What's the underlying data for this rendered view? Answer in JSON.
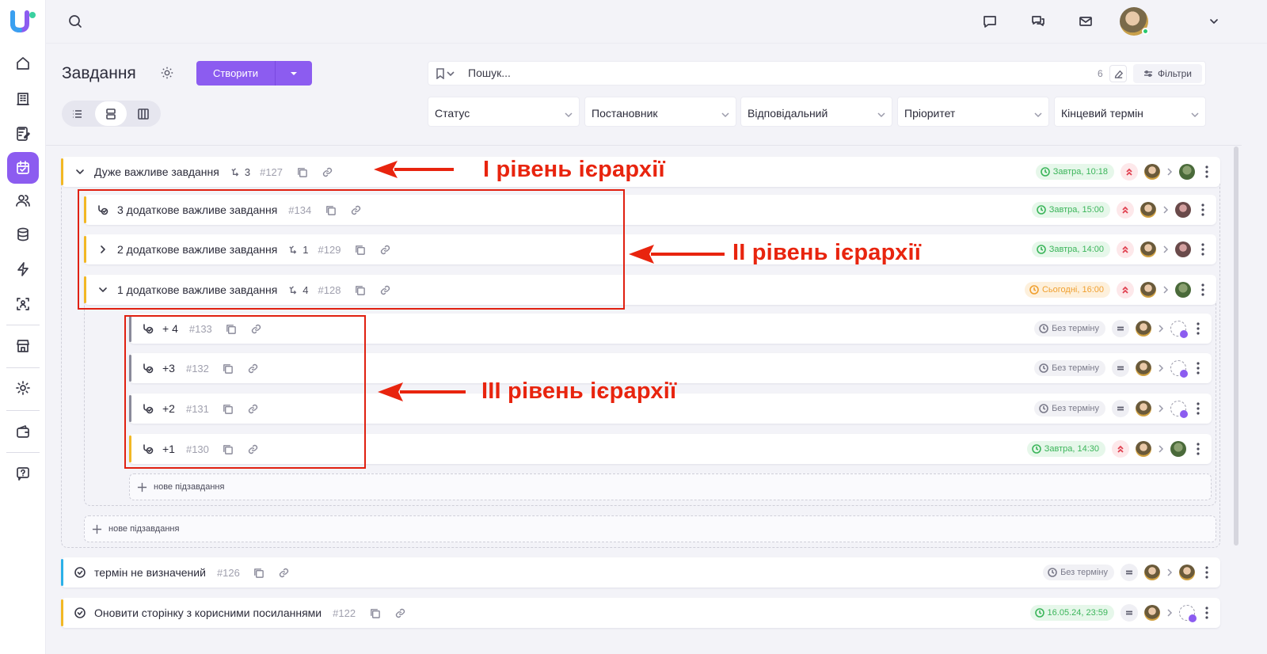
{
  "header": {
    "page_title": "Завдання",
    "create_label": "Створити",
    "search_placeholder": "Пошук...",
    "search_count": "6",
    "filters_label": "Фільтри"
  },
  "filters": [
    {
      "label": "Статус"
    },
    {
      "label": "Постановник"
    },
    {
      "label": "Відповідальний"
    },
    {
      "label": "Пріоритет"
    },
    {
      "label": "Кінцевий термін"
    }
  ],
  "tasks": {
    "main": {
      "title": "Дуже важливе завдання",
      "subcount": "3",
      "id": "#127",
      "deadline": "Завтра, 10:18"
    },
    "sub3": {
      "title": "3 додаткове важливе завдання",
      "id": "#134",
      "deadline": "Завтра, 15:00"
    },
    "sub2": {
      "title": "2 додаткове важливе завдання",
      "subcount": "1",
      "id": "#129",
      "deadline": "Завтра, 14:00"
    },
    "sub1": {
      "title": "1 додаткове важливе завдання",
      "subcount": "4",
      "id": "#128",
      "deadline": "Сьогодні, 16:00"
    },
    "l3a": {
      "title": "+ 4",
      "id": "#133",
      "deadline": "Без терміну"
    },
    "l3b": {
      "title": "+3",
      "id": "#132",
      "deadline": "Без терміну"
    },
    "l3c": {
      "title": "+2",
      "id": "#131",
      "deadline": "Без терміну"
    },
    "l3d": {
      "title": "+1",
      "id": "#130",
      "deadline": "Завтра, 14:30"
    },
    "t126": {
      "title": "термін не визначений",
      "id": "#126",
      "deadline": "Без терміну"
    },
    "t122": {
      "title": "Оновити сторінку з корисними посиланнями",
      "id": "#122",
      "deadline": "16.05.24, 23:59"
    }
  },
  "new_subtask_label": "нове підзавдання",
  "annotations": {
    "level1": "І рівень ієрархії",
    "level2": "ІІ рівень ієрархії",
    "level3": "ІІІ рівень ієрархії"
  },
  "colors": {
    "accent": "#8c5cf0",
    "annotation": "#e8240e",
    "yellow_stripe": "#f2b824",
    "blue_stripe": "#2bb0e8",
    "gray_stripe": "#8a8a9a"
  }
}
